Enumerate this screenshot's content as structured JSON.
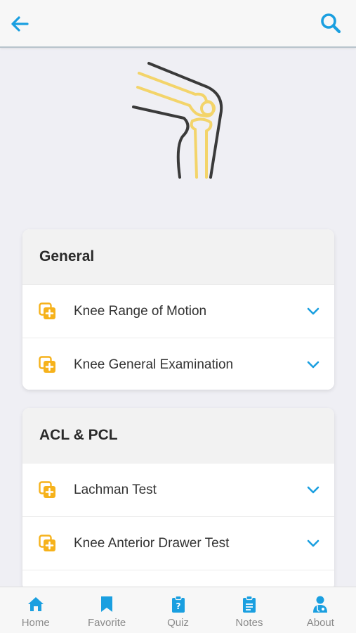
{
  "colors": {
    "accent": "#1a9fe0",
    "icon_orange": "#f6b21b",
    "bone": "#f3d46a",
    "outline": "#3a3a3a"
  },
  "topbar": {
    "back_icon": "arrow-left-icon",
    "search_icon": "search-icon"
  },
  "hero": {
    "icon": "knee-joint-illustration"
  },
  "sections": [
    {
      "title": "General",
      "items": [
        {
          "label": "Knee Range of Motion"
        },
        {
          "label": "Knee General Examination"
        }
      ]
    },
    {
      "title": "ACL & PCL",
      "items": [
        {
          "label": "Lachman Test"
        },
        {
          "label": "Knee Anterior Drawer Test"
        },
        {
          "label": ""
        }
      ]
    }
  ],
  "bottom_nav": [
    {
      "label": "Home",
      "icon": "home-icon"
    },
    {
      "label": "Favorite",
      "icon": "bookmark-icon"
    },
    {
      "label": "Quiz",
      "icon": "quiz-clipboard-icon"
    },
    {
      "label": "Notes",
      "icon": "notes-clipboard-icon"
    },
    {
      "label": "About",
      "icon": "doctor-icon"
    }
  ]
}
